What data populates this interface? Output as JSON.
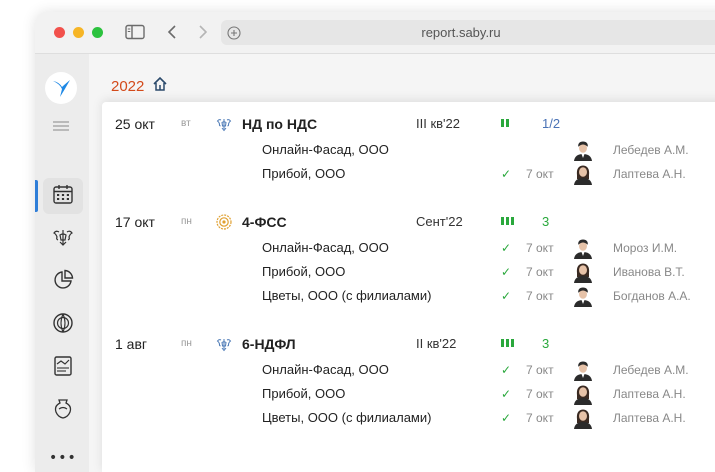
{
  "browser": {
    "url": "report.saby.ru"
  },
  "breadcrumb": {
    "year": "2022"
  },
  "colors": {
    "accent_orange": "#d34a1a",
    "ok_green": "#2aa83c",
    "link_blue": "#4a73b6",
    "active_blue": "#2f7ed8"
  },
  "sidebar": {
    "items": [
      {
        "icon": "calendar-icon",
        "active": true
      },
      {
        "icon": "eagle-emblem-icon",
        "active": false
      },
      {
        "icon": "pie-chart-icon",
        "active": false
      },
      {
        "icon": "globe-icon",
        "active": false
      },
      {
        "icon": "chart-document-icon",
        "active": false
      },
      {
        "icon": "vase-icon",
        "active": false
      }
    ],
    "more": "•••"
  },
  "reports": [
    {
      "date": "25 окт",
      "dow": "вт",
      "icon": "eagle-emblem-icon",
      "title": "НД по НДС",
      "period": "III кв'22",
      "progress_bars": 2,
      "count": "1/2",
      "subs": [
        {
          "org": "Онлайн-Фасад, ООО",
          "check": "",
          "date": "",
          "person": "Лебедев А.М."
        },
        {
          "org": "Прибой, ООО",
          "check": "✓",
          "date": "7 окт",
          "person": "Лаптева А.Н."
        }
      ]
    },
    {
      "date": "17 окт",
      "dow": "пн",
      "icon": "fss-badge-icon",
      "title": "4-ФСС",
      "period": "Сент'22",
      "progress_bars": 3,
      "count": "3",
      "subs": [
        {
          "org": "Онлайн-Фасад, ООО",
          "check": "✓",
          "date": "7 окт",
          "person": "Мороз И.М."
        },
        {
          "org": "Прибой, ООО",
          "check": "✓",
          "date": "7 окт",
          "person": "Иванова В.Т."
        },
        {
          "org": "Цветы, ООО (с филиалами)",
          "check": "✓",
          "date": "7 окт",
          "person": "Богданов А.А."
        }
      ]
    },
    {
      "date": "1 авг",
      "dow": "пн",
      "icon": "eagle-emblem-icon",
      "title": "6-НДФЛ",
      "period": "II кв'22",
      "progress_bars": 3,
      "count": "3",
      "subs": [
        {
          "org": "Онлайн-Фасад, ООО",
          "check": "✓",
          "date": "7 окт",
          "person": "Лебедев А.М."
        },
        {
          "org": "Прибой, ООО",
          "check": "✓",
          "date": "7 окт",
          "person": "Лаптева А.Н."
        },
        {
          "org": "Цветы, ООО (с филиалами)",
          "check": "✓",
          "date": "7 окт",
          "person": "Лаптева А.Н."
        }
      ]
    }
  ]
}
